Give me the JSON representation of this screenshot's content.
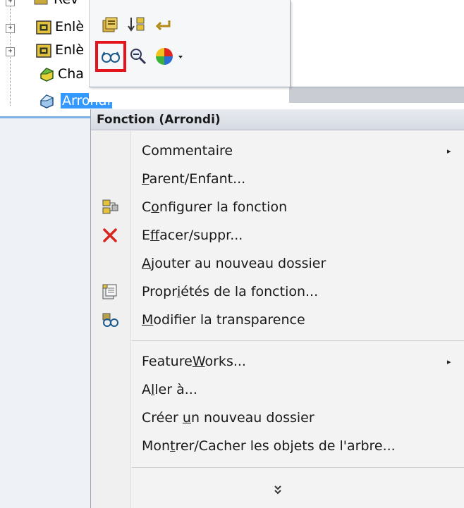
{
  "tree": {
    "items": [
      {
        "label": "Rev",
        "expander": "+"
      },
      {
        "label": "Enlè",
        "expander": "+"
      },
      {
        "label": "Enlè",
        "expander": "+"
      },
      {
        "label": "Cha",
        "expander": ""
      },
      {
        "label": "Arrondi",
        "expander": ""
      }
    ]
  },
  "toolbar": {
    "buttons": [
      {
        "icon": "properties-box-icon"
      },
      {
        "icon": "rollback-bar-icon"
      },
      {
        "icon": "return-arrow-icon"
      },
      {
        "icon": "glasses-transparency-icon",
        "highlighted": true
      },
      {
        "icon": "zoom-icon"
      },
      {
        "icon": "appearance-color-icon"
      }
    ],
    "highlight_color": "#e3141b"
  },
  "menu": {
    "title": "Fonction (Arrondi)",
    "items": [
      {
        "pre": "",
        "u": "",
        "post": "Commentaire",
        "submenu": true,
        "icon": ""
      },
      {
        "pre": "",
        "u": "P",
        "post": "arent/Enfant...",
        "submenu": false,
        "icon": ""
      },
      {
        "pre": "C",
        "u": "o",
        "post": "nfigurer la fonction",
        "submenu": false,
        "icon": "configure-icon"
      },
      {
        "pre": "E",
        "u": "f",
        "post": "facer/suppr...",
        "submenu": false,
        "icon": "delete-x-icon"
      },
      {
        "pre": "",
        "u": "A",
        "post": "jouter au nouveau dossier",
        "submenu": false,
        "icon": ""
      },
      {
        "pre": "Propr",
        "u": "i",
        "post": "étés de la fonction...",
        "submenu": false,
        "icon": "properties-icon"
      },
      {
        "pre": "",
        "u": "M",
        "post": "odifier la transparence",
        "submenu": false,
        "icon": "transparency-glasses-icon"
      },
      {
        "pre": "Feature",
        "u": "W",
        "post": "orks...",
        "submenu": true,
        "icon": ""
      },
      {
        "pre": "A",
        "u": "l",
        "post": "ler à...",
        "submenu": false,
        "icon": ""
      },
      {
        "pre": "Créer ",
        "u": "u",
        "post": "n nouveau dossier",
        "submenu": false,
        "icon": ""
      },
      {
        "pre": "Mon",
        "u": "t",
        "post": "rer/Cacher les objets de l'arbre...",
        "submenu": false,
        "icon": ""
      }
    ],
    "submenu_arrow": "▸",
    "more_chevron": "⌄⌄"
  },
  "colors": {
    "selection": "#3399ff",
    "delete_red": "#d9261c"
  }
}
